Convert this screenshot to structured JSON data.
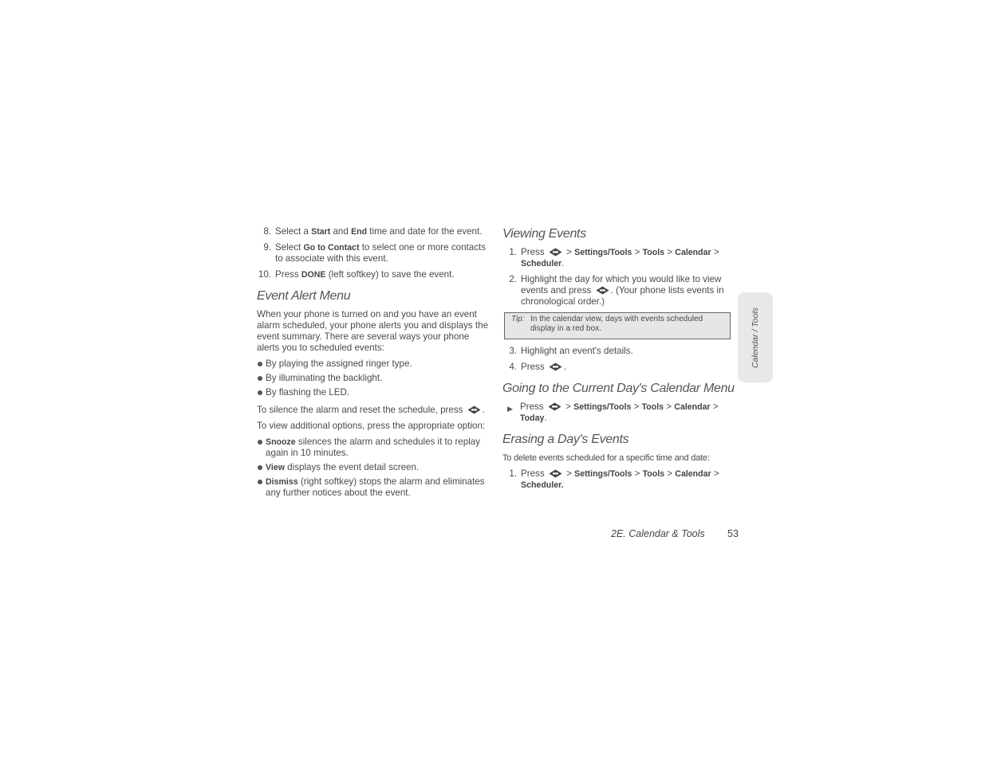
{
  "left": {
    "steps_top": [
      {
        "num": "8.",
        "parts": [
          "Select a ",
          {
            "b": "Start"
          },
          " and ",
          {
            "b": "End"
          },
          " time and date for the event."
        ]
      },
      {
        "num": "9.",
        "parts": [
          "Select ",
          {
            "b": "Go to Contact"
          },
          " to select one or more contacts to associate with this event."
        ]
      },
      {
        "num": "10.",
        "parts": [
          "Press ",
          {
            "b": "DONE"
          },
          " (left softkey) to save the event."
        ]
      }
    ],
    "heading": "Event Alert Menu",
    "intro": "When your phone is turned on and you have an event alarm scheduled, your phone alerts you and displays the event summary. There are several ways your phone alerts you to scheduled events:",
    "alert_bullets": [
      "By playing the assigned ringer type.",
      "By illuminating the backlight.",
      "By flashing the LED."
    ],
    "silence_text": "To silence the alarm and reset the schedule, press",
    "options_text": "To view additional options, press the appropriate option:",
    "option_bullets": [
      {
        "b": "Snooze",
        "text": " silences the alarm and schedules it to replay again in 10 minutes."
      },
      {
        "b": "View",
        "text": " displays the event detail screen."
      },
      {
        "b": "Dismiss",
        "text": " (right softkey) stops the alarm and eliminates any further notices about the event."
      }
    ]
  },
  "right": {
    "viewing": {
      "heading": "Viewing Events",
      "step1_num": "1.",
      "step2_num": "2.",
      "step2_pre": "Highlight the day for which you would like to view events and press",
      "step2_post": ". (Your phone lists events in chronological order.)",
      "tip_label": "Tip:",
      "tip_text": "In the calendar view, days with events scheduled display in a red box.",
      "step3_num": "3.",
      "step3": "Highlight an event's details.",
      "step4_num": "4.",
      "step4": "Press"
    },
    "current_day": {
      "heading": "Going to the Current Day's Calendar Menu",
      "final": "Today"
    },
    "erasing": {
      "heading": "Erasing a Day's Events",
      "intro": "To delete events scheduled for a specific time and date:",
      "step1_num": "1."
    },
    "path": {
      "press": "Press",
      "sep": ">",
      "settings": "Settings/Tools",
      "tools": "Tools",
      "calendar": "Calendar",
      "scheduler": "Scheduler"
    }
  },
  "side_tab": "Calendar / Tools",
  "footer": {
    "section": "2E. Calendar & Tools",
    "page": "53"
  }
}
